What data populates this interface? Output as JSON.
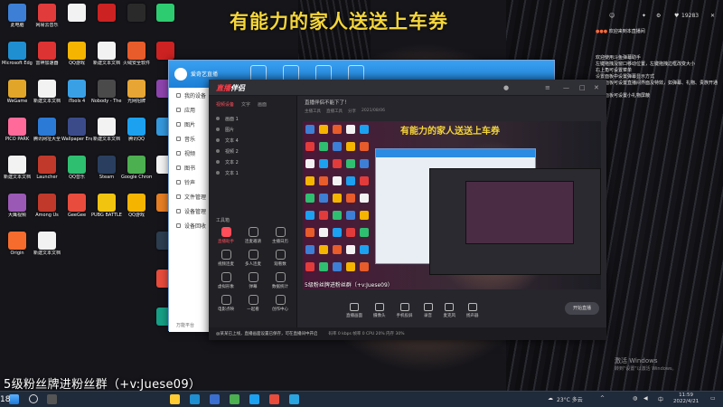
{
  "banner": "有能力的家人送送上车券",
  "caption": "5级粉丝牌进粉丝群（+v:Juese09）",
  "corner_number": "18",
  "desktop_icons": [
    {
      "label": "此电脑",
      "color": "#3d7fd6"
    },
    {
      "label": "网易云音乐",
      "color": "#e23b3b"
    },
    {
      "label": "",
      "color": "#f2f2f2"
    },
    {
      "label": "",
      "color": "#cc2222"
    },
    {
      "label": "",
      "color": "#2a2a2a"
    },
    {
      "label": "Microsoft Edge",
      "color": "#1f8fd1"
    },
    {
      "label": "雷神加速器",
      "color": "#d33"
    },
    {
      "label": "QQ游戏",
      "color": "#f4b400"
    },
    {
      "label": "新建文本文档",
      "color": "#f2f2f2"
    },
    {
      "label": "火绒安全软件",
      "color": "#e85b2a"
    },
    {
      "label": "WeGame",
      "color": "#e1a52a"
    },
    {
      "label": "新建文本文档",
      "color": "#f2f2f2"
    },
    {
      "label": "iTools 4",
      "color": "#3aa0e6"
    },
    {
      "label": "Nobody - The Turna...",
      "color": "#4a4a4a"
    },
    {
      "label": "光网招牌",
      "color": "#e6a534"
    },
    {
      "label": "PICO PARK",
      "color": "#ff6a9a"
    },
    {
      "label": "腾讯网址大全",
      "color": "#2b7ad6"
    },
    {
      "label": "Wallpaper Engine",
      "color": "#3b4b8a"
    },
    {
      "label": "新建文本文档",
      "color": "#f2f2f2"
    },
    {
      "label": "腾讯QQ",
      "color": "#1ca1f1"
    },
    {
      "label": "新建文本文档",
      "color": "#f2f2f2"
    },
    {
      "label": "Launcher",
      "color": "#c0392b"
    },
    {
      "label": "QQ音乐",
      "color": "#2fbf71"
    },
    {
      "label": "Steam",
      "color": "#2a3f5f"
    },
    {
      "label": "Google Chrome",
      "color": "#4caf50"
    },
    {
      "label": "大鹰视频",
      "color": "#9b59b6"
    },
    {
      "label": "Among Us",
      "color": "#c0392b"
    },
    {
      "label": "GeeGee",
      "color": "#e84c3d"
    },
    {
      "label": "PUBG BATTLEGR...",
      "color": "#f1c40f"
    },
    {
      "label": "QQ游戏",
      "color": "#f4b400"
    },
    {
      "label": "Origin",
      "color": "#f56c2d"
    },
    {
      "label": "新建文本文档",
      "color": "#f2f2f2"
    }
  ],
  "back_window": {
    "title": "爱奇艺直播",
    "menu": [
      "我的设备",
      "应用",
      "图片",
      "音乐",
      "视频",
      "图书",
      "铃声",
      "文件管理",
      "设备管理",
      "设备回收"
    ],
    "footer": "万能平台"
  },
  "main_window": {
    "brand_prefix": "直播",
    "brand": "伴侣",
    "tabs": [
      "视频设备",
      "文字",
      "画面"
    ],
    "scene_rows": [
      "画面 1",
      "图片",
      "文本 4",
      "视频 2",
      "文本 2",
      "文本 1"
    ],
    "toolbox_title": "工具箱",
    "tools": [
      "直播助手",
      "连麦邀请",
      "主播日历",
      "视频连麦",
      "多人连麦",
      "观看数",
      "虚拟形象",
      "弹幕",
      "数据统计",
      "电影点映",
      "一起看",
      "创作中心"
    ],
    "scene_title": "直播伴侣不能下了！",
    "scene_sub": [
      "主播工具",
      "直播工具",
      "分享",
      "2021/08/06"
    ],
    "controls": [
      "直播画面",
      "摄像头",
      "手机投屏",
      "录音",
      "麦克风",
      "扬声器"
    ],
    "live_button": "开始直播",
    "status": "@某某已上线，直播画面设置已保存，可在直播间中开启",
    "status2": "码率 0 kbps    帧率 0    CPU 20%    内存 30%"
  },
  "chat": {
    "welcome": "欢迎来到本直播间",
    "lines": [
      "欢迎使用斗鱼弹幕助手",
      "左键拖拽及窗口移动位置，左键拖拽边框改变大小",
      "右上角可设置菜单",
      "设置面板中设置弹幕显示方式",
      "设置面板可设置直播间界面及特效，如弹幕、礼物、贵族开通等",
      "设置面板可设置小礼物屏蔽"
    ],
    "viewer_count": "19283"
  },
  "windows_activate": {
    "title": "激活 Windows",
    "sub": "转到\"设置\"以激活 Windows。"
  },
  "taskbar": {
    "weather": "23°C 多云",
    "time": "11:59",
    "date": "2022/4/21",
    "lang": "中"
  }
}
